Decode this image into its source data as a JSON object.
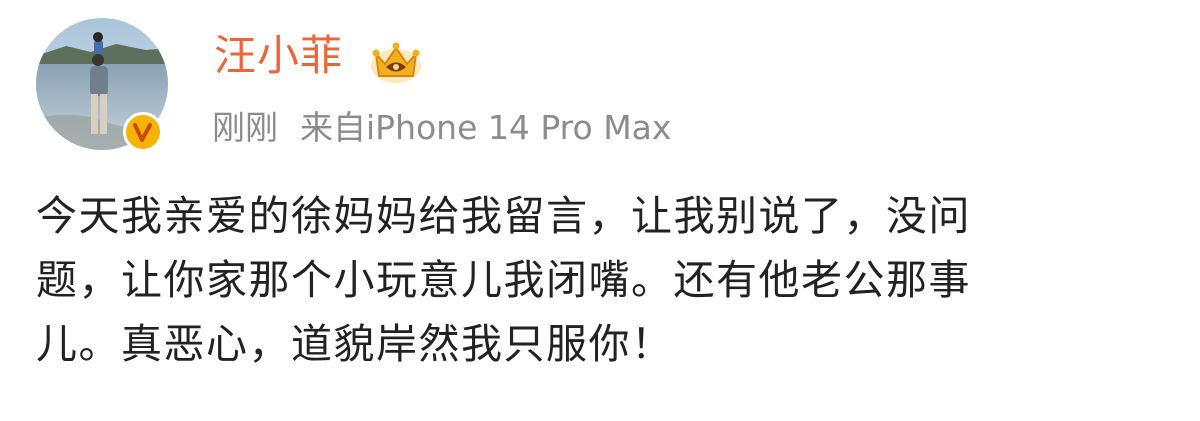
{
  "post": {
    "author_name": "汪小菲",
    "timestamp": "刚刚",
    "source": "来自iPhone 14 Pro Max",
    "text_lines": [
      "今天我亲爱的徐妈妈给我留言，让我别说了，没问",
      "题，让你家那个小玩意儿我闭嘴。还有他老公那事",
      "儿。真恶心，道貌岸然我只服你！"
    ],
    "icons": {
      "badge": "verified-v-icon",
      "crown": "vip-crown-icon"
    },
    "colors": {
      "author_name": "#e8663a",
      "meta_text": "#8c8c8c",
      "body_text": "#222222",
      "verified_badge": "#f6b400"
    }
  }
}
